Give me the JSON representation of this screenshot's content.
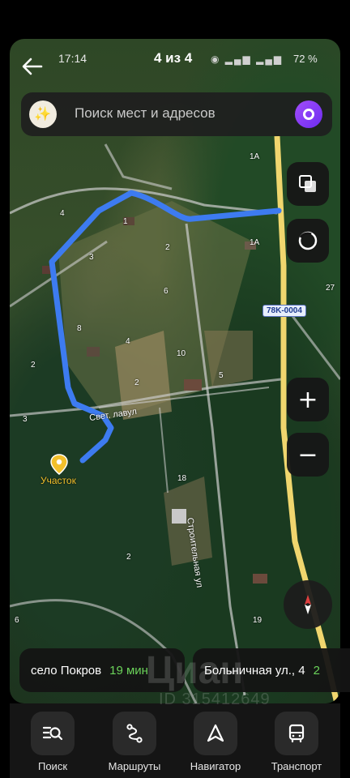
{
  "status": {
    "time": "17:14",
    "battery": "72 %"
  },
  "header": {
    "page_counter": "4 из 4"
  },
  "search": {
    "placeholder": "Поиск мест и адресов"
  },
  "map": {
    "road_badge": "78K-0004",
    "street_labels": [
      "Свет. лавул",
      "Строительная ул"
    ],
    "house_numbers": [
      "1А",
      "4",
      "1",
      "2",
      "1А",
      "3",
      "6",
      "27",
      "8",
      "4",
      "10",
      "2",
      "2",
      "5",
      "3",
      "18",
      "2",
      "6",
      "19"
    ],
    "place_pin": {
      "label": "Участок"
    }
  },
  "route_chips": [
    {
      "destination": "село Покров",
      "time": "19 мин"
    },
    {
      "destination": "Больничная ул., 4",
      "time": "2"
    }
  ],
  "bottom_nav": [
    {
      "label": "Поиск",
      "icon": "search-list-icon"
    },
    {
      "label": "Маршруты",
      "icon": "routes-icon"
    },
    {
      "label": "Навигатор",
      "icon": "navigator-arrow-icon"
    },
    {
      "label": "Транспорт",
      "icon": "bus-icon"
    }
  ],
  "watermark": {
    "brand": "Циан",
    "id": "ID 315412649"
  },
  "colors": {
    "route": "#3d7bf0",
    "highway": "#f0d66e",
    "pin": "#f2c02b",
    "chip_time": "#6bd35a"
  }
}
